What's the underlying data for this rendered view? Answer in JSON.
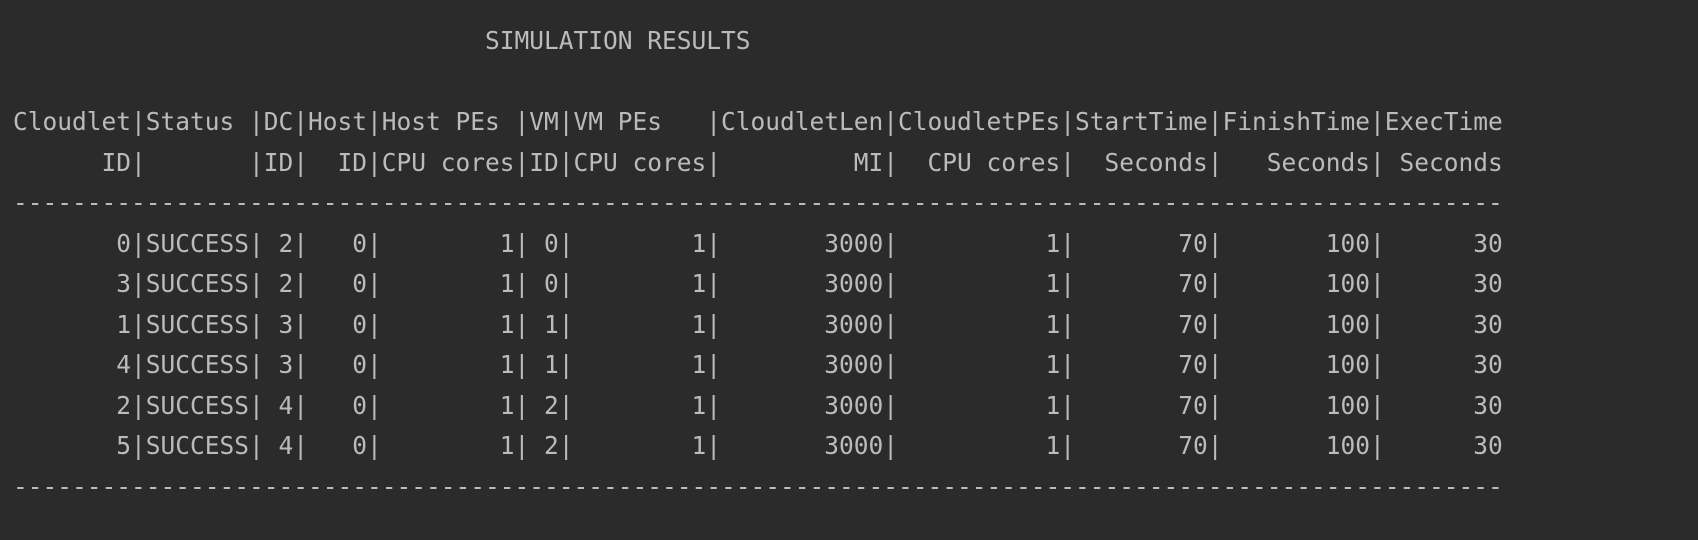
{
  "console": {
    "title_line": "                                SIMULATION RESULTS",
    "header_line_1": "Cloudlet|Status |DC|Host|Host PEs |VM|VM PEs   |CloudletLen|CloudletPEs|StartTime|FinishTime|ExecTime",
    "header_line_2": "      ID|       |ID|  ID|CPU cores|ID|CPU cores|         MI|  CPU cores|  Seconds|   Seconds| Seconds",
    "separator_top": "-----------------------------------------------------------------------------------------------------",
    "rows": [
      "       0|SUCCESS| 2|   0|        1| 0|        1|       3000|          1|       70|       100|      30",
      "       3|SUCCESS| 2|   0|        1| 0|        1|       3000|          1|       70|       100|      30",
      "       1|SUCCESS| 3|   0|        1| 1|        1|       3000|          1|       70|       100|      30",
      "       4|SUCCESS| 3|   0|        1| 1|        1|       3000|          1|       70|       100|      30",
      "       2|SUCCESS| 4|   0|        1| 2|        1|       3000|          1|       70|       100|      30",
      "       5|SUCCESS| 4|   0|        1| 2|        1|       3000|          1|       70|       100|      30"
    ],
    "separator_bottom": "-----------------------------------------------------------------------------------------------------"
  }
}
